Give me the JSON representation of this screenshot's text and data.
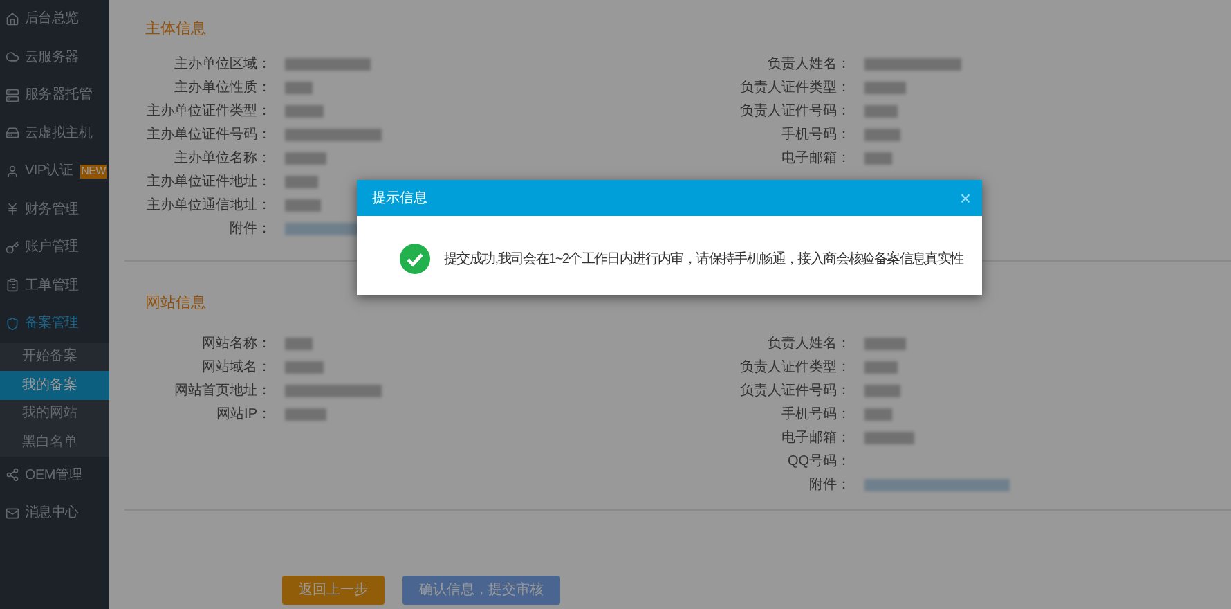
{
  "sidebar": {
    "items": [
      {
        "label": "后台总览",
        "selected": false,
        "expanded": false
      },
      {
        "label": "云服务器",
        "selected": false,
        "expanded": false
      },
      {
        "label": "服务器托管",
        "selected": false,
        "expanded": false
      },
      {
        "label": "云虚拟主机",
        "selected": false,
        "expanded": false
      },
      {
        "label": "VIP认证",
        "badge": "NEW",
        "selected": false,
        "expanded": false
      },
      {
        "label": "财务管理",
        "selected": false,
        "expanded": false
      },
      {
        "label": "账户管理",
        "selected": false,
        "expanded": false
      },
      {
        "label": "工单管理",
        "selected": false,
        "expanded": false
      },
      {
        "label": "备案管理",
        "selected": false,
        "expanded": true,
        "children": [
          {
            "label": "开始备案",
            "selected": false
          },
          {
            "label": "我的备案",
            "selected": true
          },
          {
            "label": "我的网站",
            "selected": false
          },
          {
            "label": "黑白名单",
            "selected": false
          }
        ]
      },
      {
        "label": "OEM管理",
        "selected": false,
        "expanded": false
      },
      {
        "label": "消息中心",
        "selected": false,
        "expanded": false
      }
    ]
  },
  "sections": [
    {
      "title": "主体信息",
      "left": [
        {
          "label": "主办单位区域：",
          "kind": "text"
        },
        {
          "label": "主办单位性质：",
          "kind": "text"
        },
        {
          "label": "主办单位证件类型：",
          "kind": "text"
        },
        {
          "label": "主办单位证件号码：",
          "kind": "text"
        },
        {
          "label": "主办单位名称：",
          "kind": "text"
        },
        {
          "label": "主办单位证件地址：",
          "kind": "text"
        },
        {
          "label": "主办单位通信地址：",
          "kind": "text"
        },
        {
          "label": "附件：",
          "kind": "link"
        }
      ],
      "right": [
        {
          "label": "负责人姓名：",
          "kind": "text"
        },
        {
          "label": "负责人证件类型：",
          "kind": "text"
        },
        {
          "label": "负责人证件号码：",
          "kind": "text"
        },
        {
          "label": "手机号码：",
          "kind": "text"
        },
        {
          "label": "电子邮箱：",
          "kind": "text"
        }
      ]
    },
    {
      "title": "网站信息",
      "left": [
        {
          "label": "网站名称：",
          "kind": "text"
        },
        {
          "label": "网站域名：",
          "kind": "text"
        },
        {
          "label": "网站首页地址：",
          "kind": "text"
        },
        {
          "label": "网站IP：",
          "kind": "text"
        }
      ],
      "right": [
        {
          "label": "负责人姓名：",
          "kind": "text"
        },
        {
          "label": "负责人证件类型：",
          "kind": "text"
        },
        {
          "label": "负责人证件号码：",
          "kind": "text"
        },
        {
          "label": "手机号码：",
          "kind": "text"
        },
        {
          "label": "电子邮箱：",
          "kind": "text"
        },
        {
          "label": "QQ号码：",
          "kind": "empty"
        },
        {
          "label": "附件：",
          "kind": "link"
        }
      ]
    }
  ],
  "buttons": [
    {
      "label": "返回上一步",
      "kind": "back"
    },
    {
      "label": "确认信息，提交审核",
      "kind": "submit"
    }
  ],
  "dialog": {
    "title": "提示信息",
    "close": "×",
    "message": "提交成功,我司会在1~2个工作日内进行内审，请保持手机畅通，接入商会核验备案信息真实性"
  }
}
